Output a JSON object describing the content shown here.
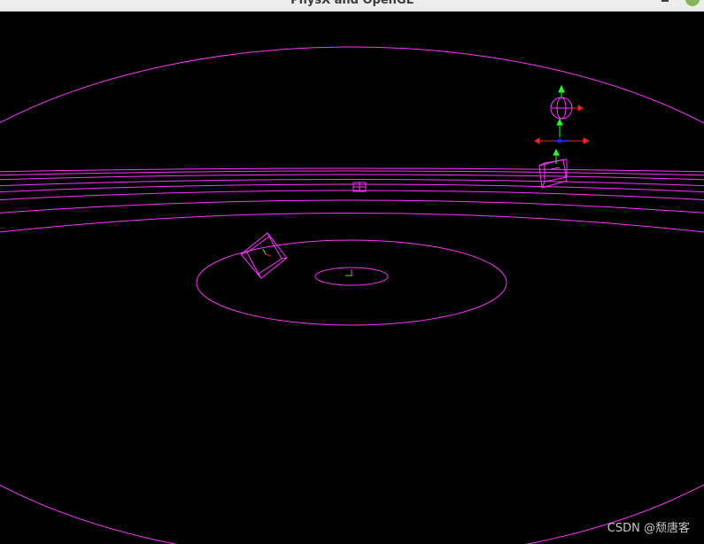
{
  "window": {
    "title": "PhysX and OpenGL",
    "minimize_icon": "minimize-icon",
    "close_icon": "close-icon",
    "close_color": "#8bb35a"
  },
  "scene": {
    "background_color": "#000000",
    "wireframe_color": "#ff33ff",
    "axis_colors": {
      "x": "#ff2020",
      "y": "#20ff20",
      "z": "#2020ff"
    },
    "objects": [
      "ground-plane-rings",
      "tilted-cube",
      "distant-small-cube",
      "stacked-cube-with-gizmo",
      "sphere-with-gizmo",
      "origin-axis-marker"
    ]
  },
  "watermark": {
    "text": "CSDN @颓唐客"
  }
}
